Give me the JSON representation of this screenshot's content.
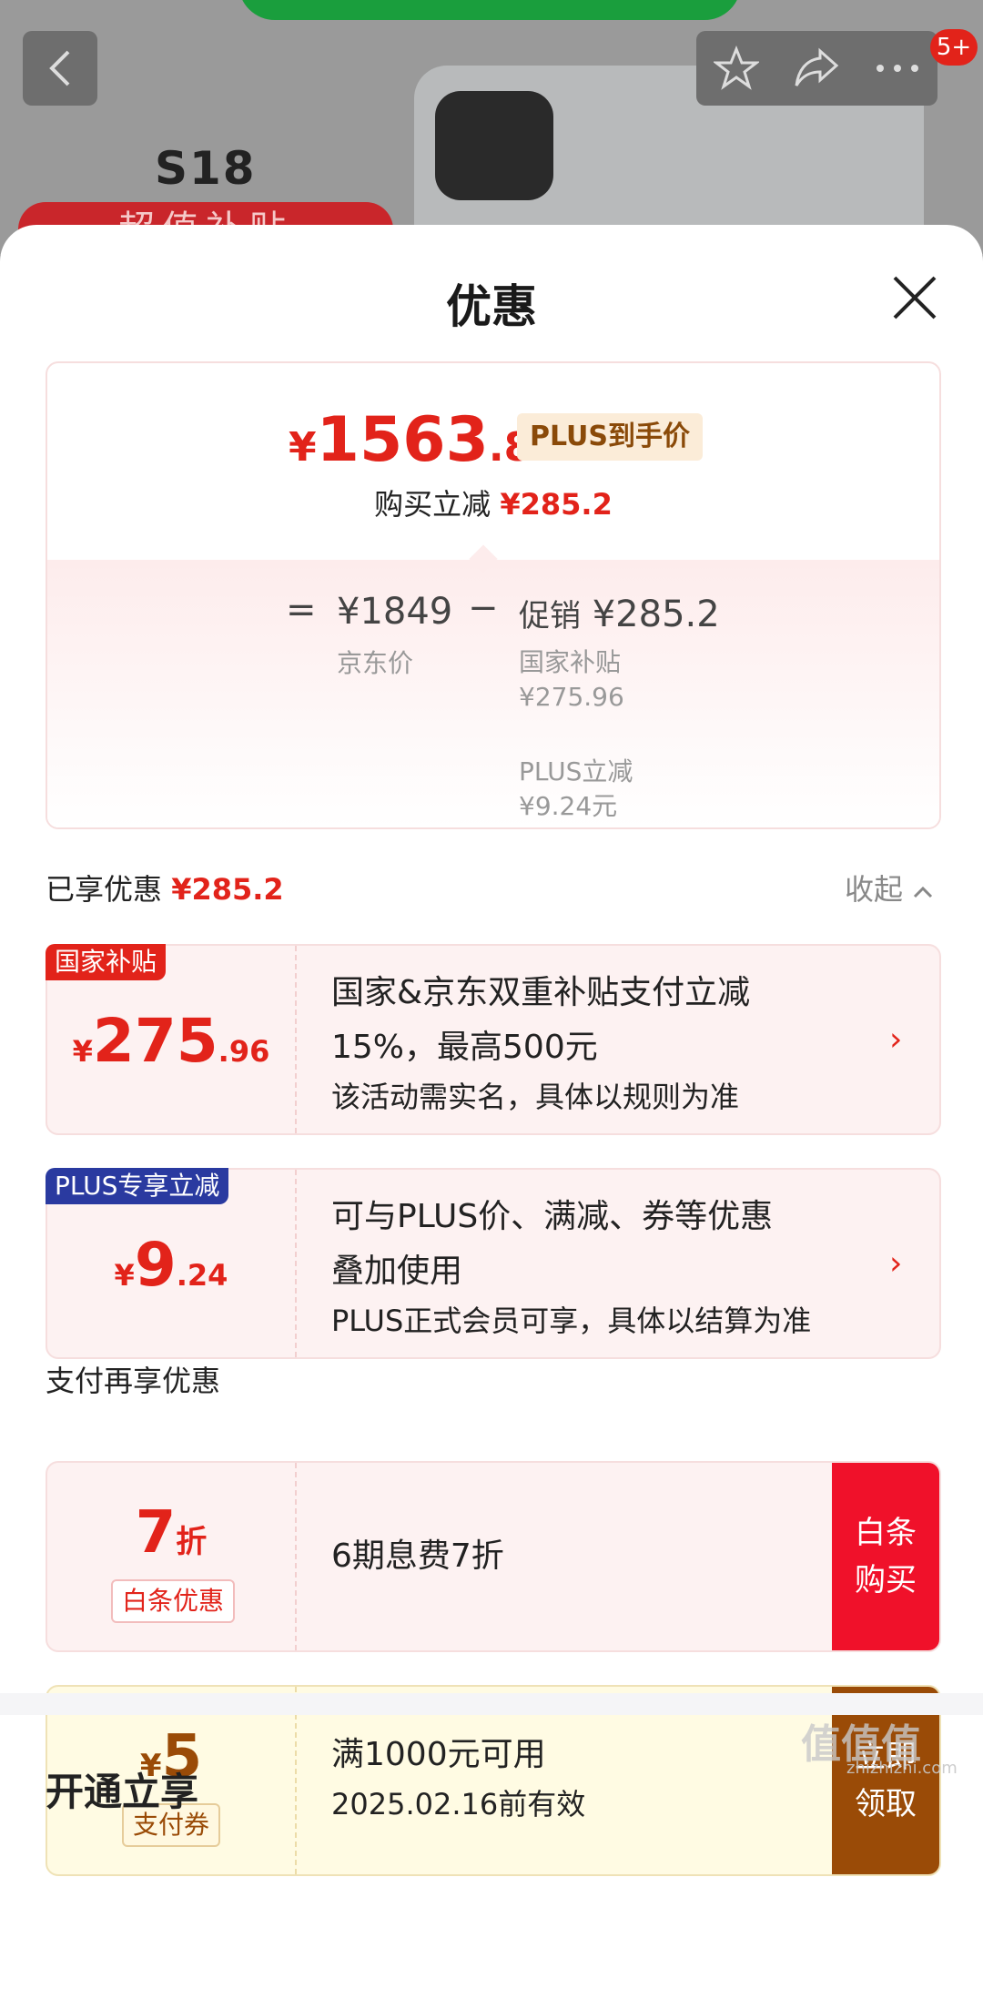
{
  "header": {
    "product_model": "S18",
    "banner_text": "超值补贴",
    "cart_badge": "5+"
  },
  "sheet": {
    "title": "优惠"
  },
  "price_card": {
    "currency": "¥",
    "final_int": "1563",
    "final_dec": ".8",
    "plus_tag": "PLUS到手价",
    "instant_label": "购买立减",
    "instant_value": "¥285.2",
    "eq": "=",
    "jd_price": "¥1849",
    "jd_label": "京东价",
    "minus": "−",
    "promo_label": "促销",
    "promo_value": "¥285.2",
    "sub1_label": "国家补贴",
    "sub1_value": "¥275.96",
    "sub2_label": "PLUS立减",
    "sub2_value": "¥9.24元"
  },
  "enjoyed": {
    "label": "已享优惠",
    "value": "¥285.2",
    "collapse": "收起"
  },
  "coupons": [
    {
      "tag": "国家补贴",
      "tag_color": "#e2231a",
      "currency": "¥",
      "int": "275",
      "dec": ".96",
      "line1": "国家&京东双重补贴支付立减",
      "line2": "15%，最高500元",
      "desc": "该活动需实名，具体以规则为准",
      "arrow": "›"
    },
    {
      "tag": "PLUS专享立减",
      "tag_color": "#2a3aa0",
      "currency": "¥",
      "int": "9",
      "dec": ".24",
      "line1": "可与PLUS价、满减、券等优惠",
      "line2": "叠加使用",
      "desc": "PLUS正式会员可享，具体以结算为准",
      "arrow": "›"
    }
  ],
  "pay": {
    "title": "支付再享优惠",
    "baitiao": {
      "big": "7",
      "big_unit": "折",
      "chip": "白条优惠",
      "body": "6期息费7折",
      "btn_line1": "白条",
      "btn_line2": "购买",
      "color": "#e2231a"
    },
    "voucher": {
      "currency": "¥",
      "big": "5",
      "chip": "支付券",
      "line1": "满1000元可用",
      "line2": "2025.02.16前有效",
      "btn_line1": "立即",
      "btn_line2": "领取",
      "color": "#9a4b07"
    }
  },
  "next_section": {
    "title": "开通立享"
  },
  "watermark": {
    "main": "值值值",
    "sub": "zhizhizhi.com"
  }
}
